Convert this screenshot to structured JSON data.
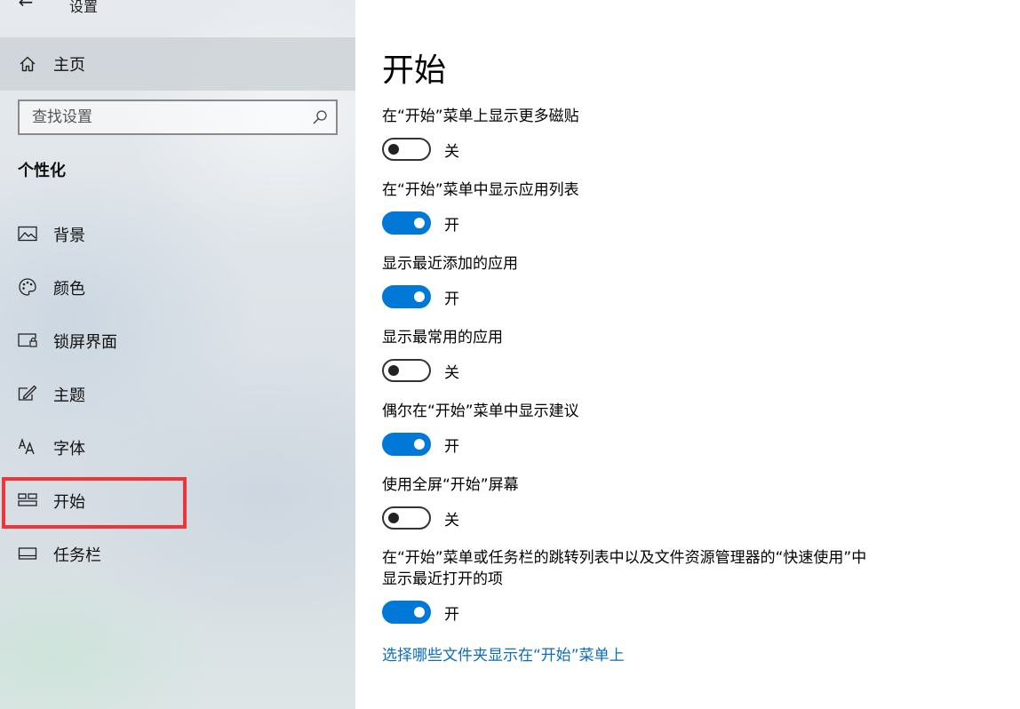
{
  "window": {
    "title": "设置"
  },
  "sidebar": {
    "home_label": "主页",
    "search_placeholder": "查找设置",
    "section_title": "个性化",
    "items": [
      {
        "label": "背景",
        "icon": "image-icon"
      },
      {
        "label": "颜色",
        "icon": "palette-icon"
      },
      {
        "label": "锁屏界面",
        "icon": "lock-screen-icon"
      },
      {
        "label": "主题",
        "icon": "theme-brush-icon"
      },
      {
        "label": "字体",
        "icon": "font-icon"
      },
      {
        "label": "开始",
        "icon": "start-tiles-icon",
        "selected": true
      },
      {
        "label": "任务栏",
        "icon": "taskbar-icon"
      }
    ]
  },
  "main": {
    "title": "开始",
    "settings": [
      {
        "label": "在“开始”菜单上显示更多磁贴",
        "on": false,
        "state_label": "关"
      },
      {
        "label": "在“开始”菜单中显示应用列表",
        "on": true,
        "state_label": "开"
      },
      {
        "label": "显示最近添加的应用",
        "on": true,
        "state_label": "开"
      },
      {
        "label": "显示最常用的应用",
        "on": false,
        "state_label": "关"
      },
      {
        "label": "偶尔在“开始”菜单中显示建议",
        "on": true,
        "state_label": "开"
      },
      {
        "label": "使用全屏“开始”屏幕",
        "on": false,
        "state_label": "关"
      },
      {
        "label_line1": "在“开始”菜单或任务栏的跳转列表中以及文件资源管理器的“快速使用”中",
        "label_line2": "显示最近打开的项",
        "on": true,
        "state_label": "开"
      }
    ],
    "link": "选择哪些文件夹显示在“开始”菜单上"
  },
  "colors": {
    "accent": "#0078d7",
    "highlight": "#f0353a",
    "link": "#0a6bbf"
  }
}
